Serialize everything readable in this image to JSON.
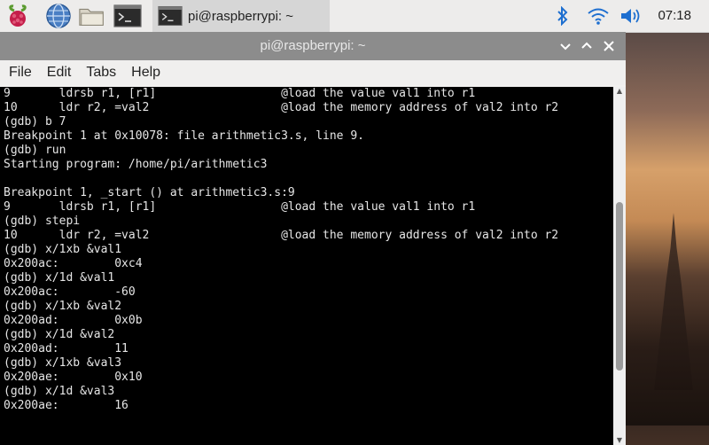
{
  "panel": {
    "task_label": "pi@raspberrypi: ~",
    "clock": "07:18",
    "icons": [
      "raspberry-menu-icon",
      "web-browser-icon",
      "file-manager-icon",
      "terminal-icon",
      "bluetooth-icon",
      "wifi-icon",
      "volume-icon"
    ]
  },
  "window": {
    "title": "pi@raspberrypi: ~",
    "buttons": [
      "minimize",
      "maximize",
      "close"
    ],
    "menu": [
      "File",
      "Edit",
      "Tabs",
      "Help"
    ]
  },
  "terminal": {
    "lines": [
      "9       ldrsb r1, [r1]                  @load the value val1 into r1",
      "10      ldr r2, =val2                   @load the memory address of val2 into r2",
      "(gdb) b 7",
      "Breakpoint 1 at 0x10078: file arithmetic3.s, line 9.",
      "(gdb) run",
      "Starting program: /home/pi/arithmetic3",
      "",
      "Breakpoint 1, _start () at arithmetic3.s:9",
      "9       ldrsb r1, [r1]                  @load the value val1 into r1",
      "(gdb) stepi",
      "10      ldr r2, =val2                   @load the memory address of val2 into r2",
      "(gdb) x/1xb &val1",
      "0x200ac:        0xc4",
      "(gdb) x/1d &val1",
      "0x200ac:        -60",
      "(gdb) x/1xb &val2",
      "0x200ad:        0x0b",
      "(gdb) x/1d &val2",
      "0x200ad:        11",
      "(gdb) x/1xb &val3",
      "0x200ae:        0x10",
      "(gdb) x/1d &val3",
      "0x200ae:        16"
    ]
  }
}
